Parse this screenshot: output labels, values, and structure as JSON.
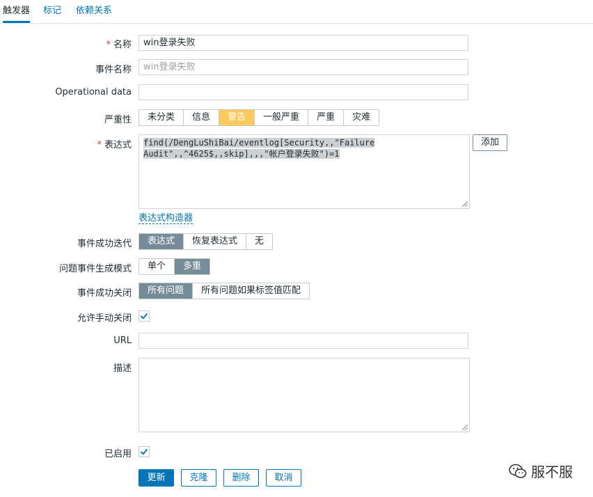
{
  "tabs": [
    "触发器",
    "标记",
    "依赖关系"
  ],
  "form": {
    "name": {
      "label": "名称",
      "required_mark": "*",
      "value": "win登录失败"
    },
    "event_name": {
      "label": "事件名称",
      "placeholder": "win登录失败"
    },
    "operational_data": {
      "label": "Operational data",
      "value": ""
    },
    "severity": {
      "label": "严重性",
      "options": [
        "未分类",
        "信息",
        "警告",
        "一般严重",
        "严重",
        "灾难"
      ],
      "selected": "警告"
    },
    "expression": {
      "label": "表达式",
      "required_mark": "*",
      "line1": "find(/DengLuShiBai/eventlog[Security,,\"Failure ",
      "line2": "Audit\",,^4625$,,skip],,,\"帐户登录失败\")=1",
      "add_button": "添加",
      "constructor_link": "表达式构造器"
    },
    "ok_event_generation": {
      "label": "事件成功迭代",
      "options": [
        "表达式",
        "恢复表达式",
        "无"
      ],
      "selected": "表达式"
    },
    "problem_event_mode": {
      "label": "问题事件生成模式",
      "options": [
        "单个",
        "多重"
      ],
      "selected": "多重"
    },
    "ok_event_closes": {
      "label": "事件成功关闭",
      "options": [
        "所有问题",
        "所有问题如果标签值匹配"
      ],
      "selected": "所有问题"
    },
    "manual_close": {
      "label": "允许手动关闭",
      "checked": true
    },
    "url": {
      "label": "URL",
      "value": ""
    },
    "description": {
      "label": "描述",
      "value": ""
    },
    "enabled": {
      "label": "已启用",
      "checked": true
    }
  },
  "buttons": {
    "update": "更新",
    "clone": "克隆",
    "delete": "删除",
    "cancel": "取消"
  },
  "watermark": {
    "text": "服不服",
    "icon": "wechat-icon"
  },
  "colors": {
    "accent": "#0275b8",
    "warning": "#ffc859",
    "selected": "#768d99",
    "required": "#e33734"
  }
}
